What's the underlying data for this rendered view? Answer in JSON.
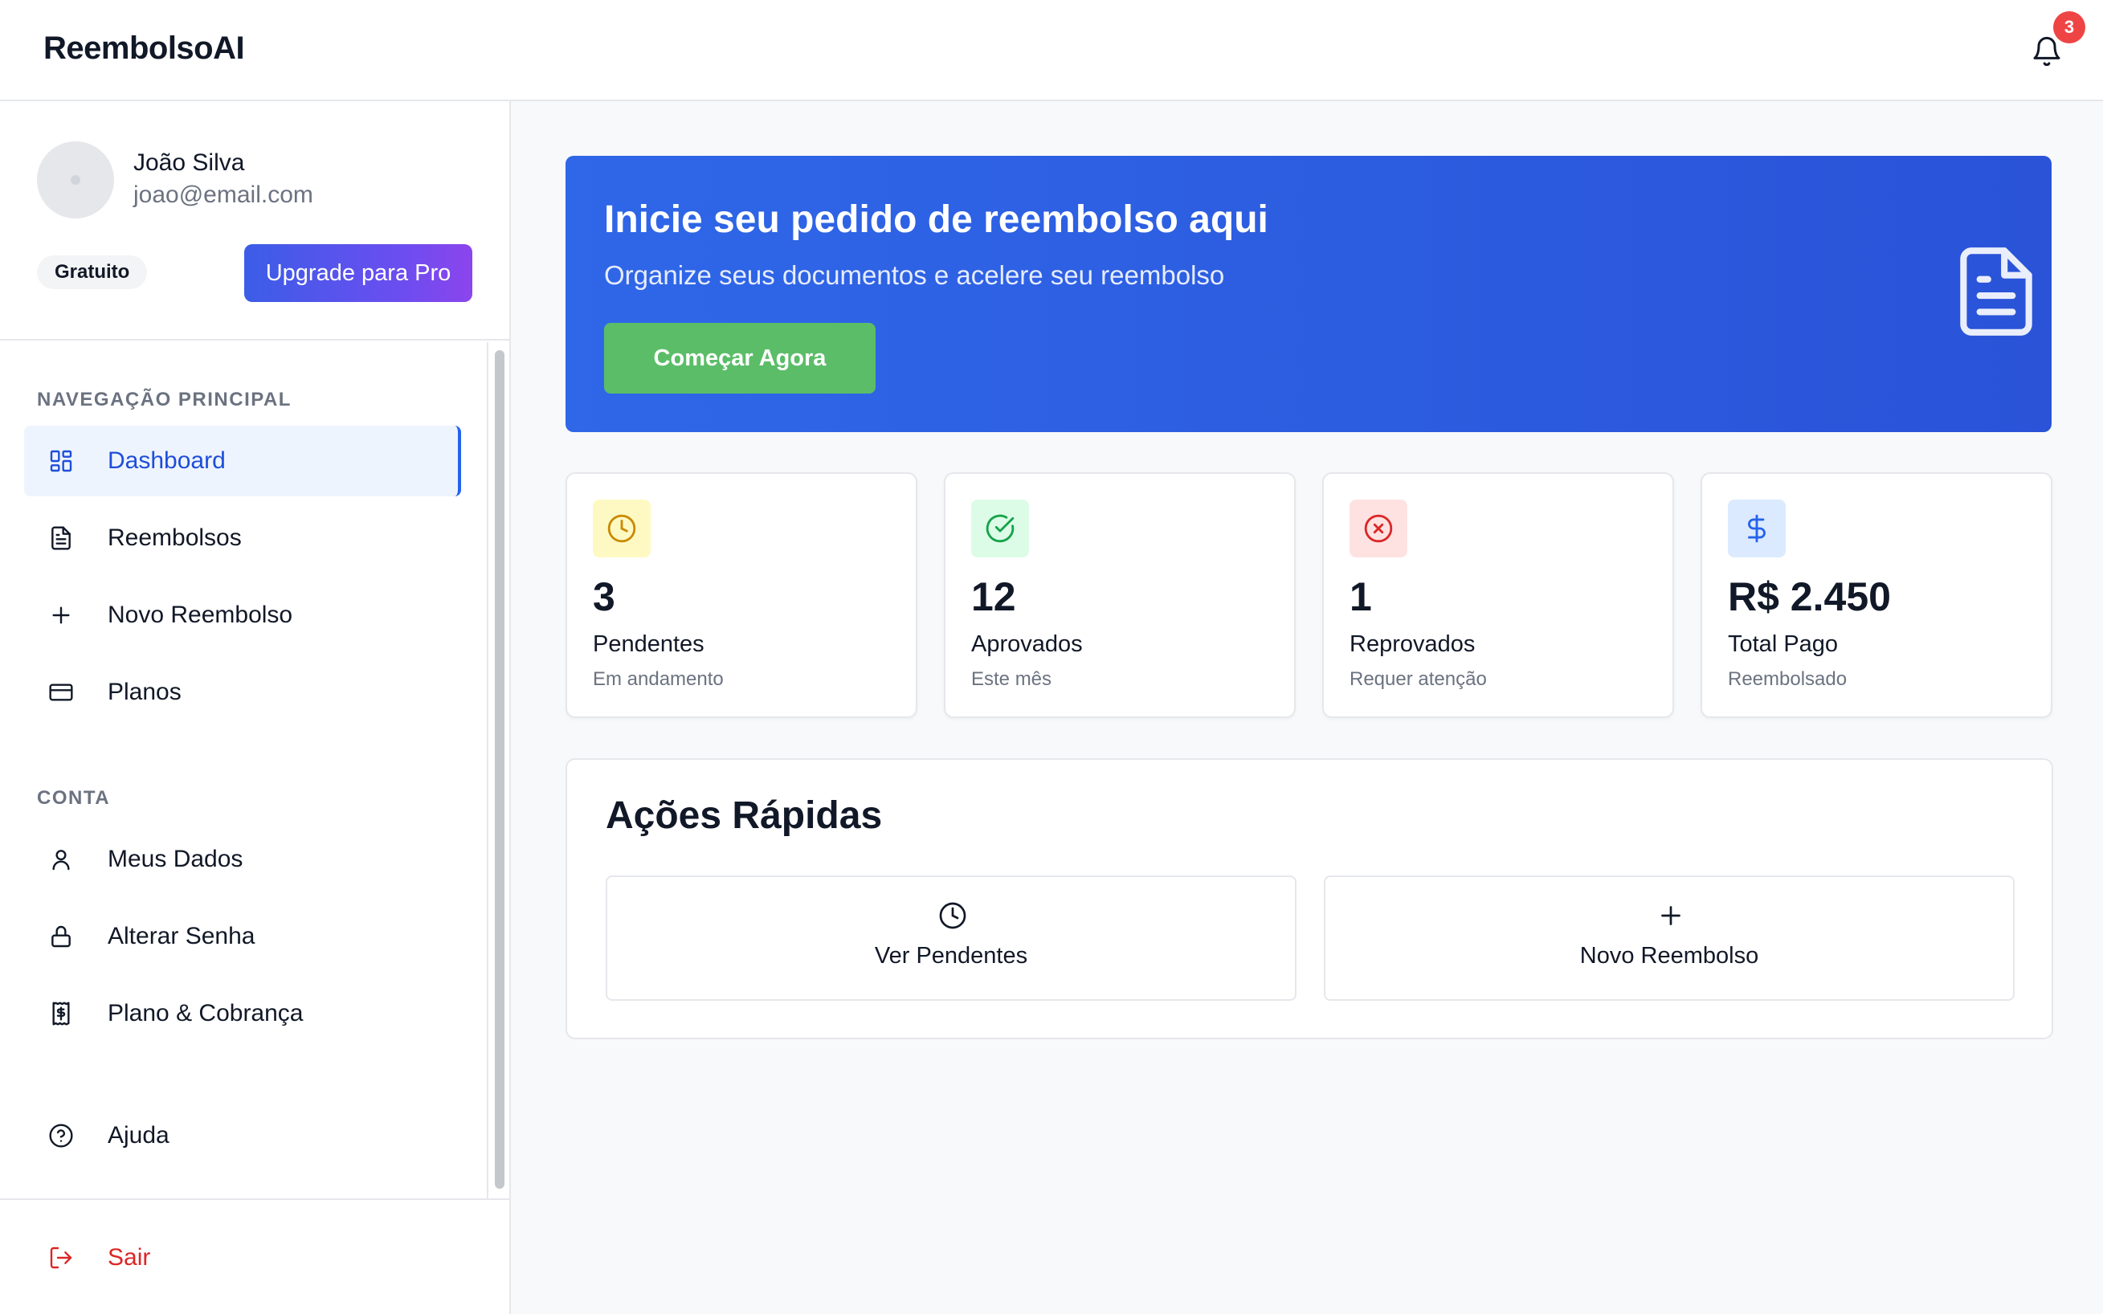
{
  "app": {
    "title": "ReembolsoAI",
    "notifications_count": "3"
  },
  "user": {
    "name": "João Silva",
    "email": "joao@email.com",
    "plan": "Gratuito",
    "upgrade_label": "Upgrade para Pro"
  },
  "nav": {
    "main_title": "NAVEGAÇÃO PRINCIPAL",
    "main_items": [
      {
        "label": "Dashboard",
        "icon": "dashboard-grid-icon",
        "active": true
      },
      {
        "label": "Reembolsos",
        "icon": "document-icon"
      },
      {
        "label": "Novo Reembolso",
        "icon": "plus-icon"
      },
      {
        "label": "Planos",
        "icon": "credit-card-icon"
      }
    ],
    "account_title": "CONTA",
    "account_items": [
      {
        "label": "Meus Dados",
        "icon": "user-icon"
      },
      {
        "label": "Alterar Senha",
        "icon": "lock-icon"
      },
      {
        "label": "Plano & Cobrança",
        "icon": "billing-icon"
      }
    ],
    "help_label": "Ajuda",
    "logout_label": "Sair"
  },
  "hero": {
    "title": "Inicie seu pedido de reembolso aqui",
    "subtitle": "Organize seus documentos e acelere seu reembolso",
    "button": "Começar Agora"
  },
  "stats": [
    {
      "value": "3",
      "label": "Pendentes",
      "sub": "Em andamento",
      "icon": "clock-icon",
      "color": "#ca8a04",
      "bg": "#fef9c3"
    },
    {
      "value": "12",
      "label": "Aprovados",
      "sub": "Este mês",
      "icon": "check-circle-icon",
      "color": "#16a34a",
      "bg": "#dcfce7"
    },
    {
      "value": "1",
      "label": "Reprovados",
      "sub": "Requer atenção",
      "icon": "x-circle-icon",
      "color": "#dc2626",
      "bg": "#fee2e2"
    },
    {
      "value": "R$ 2.450",
      "label": "Total Pago",
      "sub": "Reembolsado",
      "icon": "dollar-icon",
      "color": "#2563eb",
      "bg": "#dbeafe"
    }
  ],
  "quick_actions": {
    "title": "Ações Rápidas",
    "items": [
      {
        "label": "Ver Pendentes",
        "icon": "clock-icon"
      },
      {
        "label": "Novo Reembolso",
        "icon": "plus-icon"
      }
    ]
  },
  "colors": {
    "primary": "#2563eb",
    "hero": "#2b5ee0",
    "success": "#5bbd68",
    "danger": "#dc2626"
  }
}
